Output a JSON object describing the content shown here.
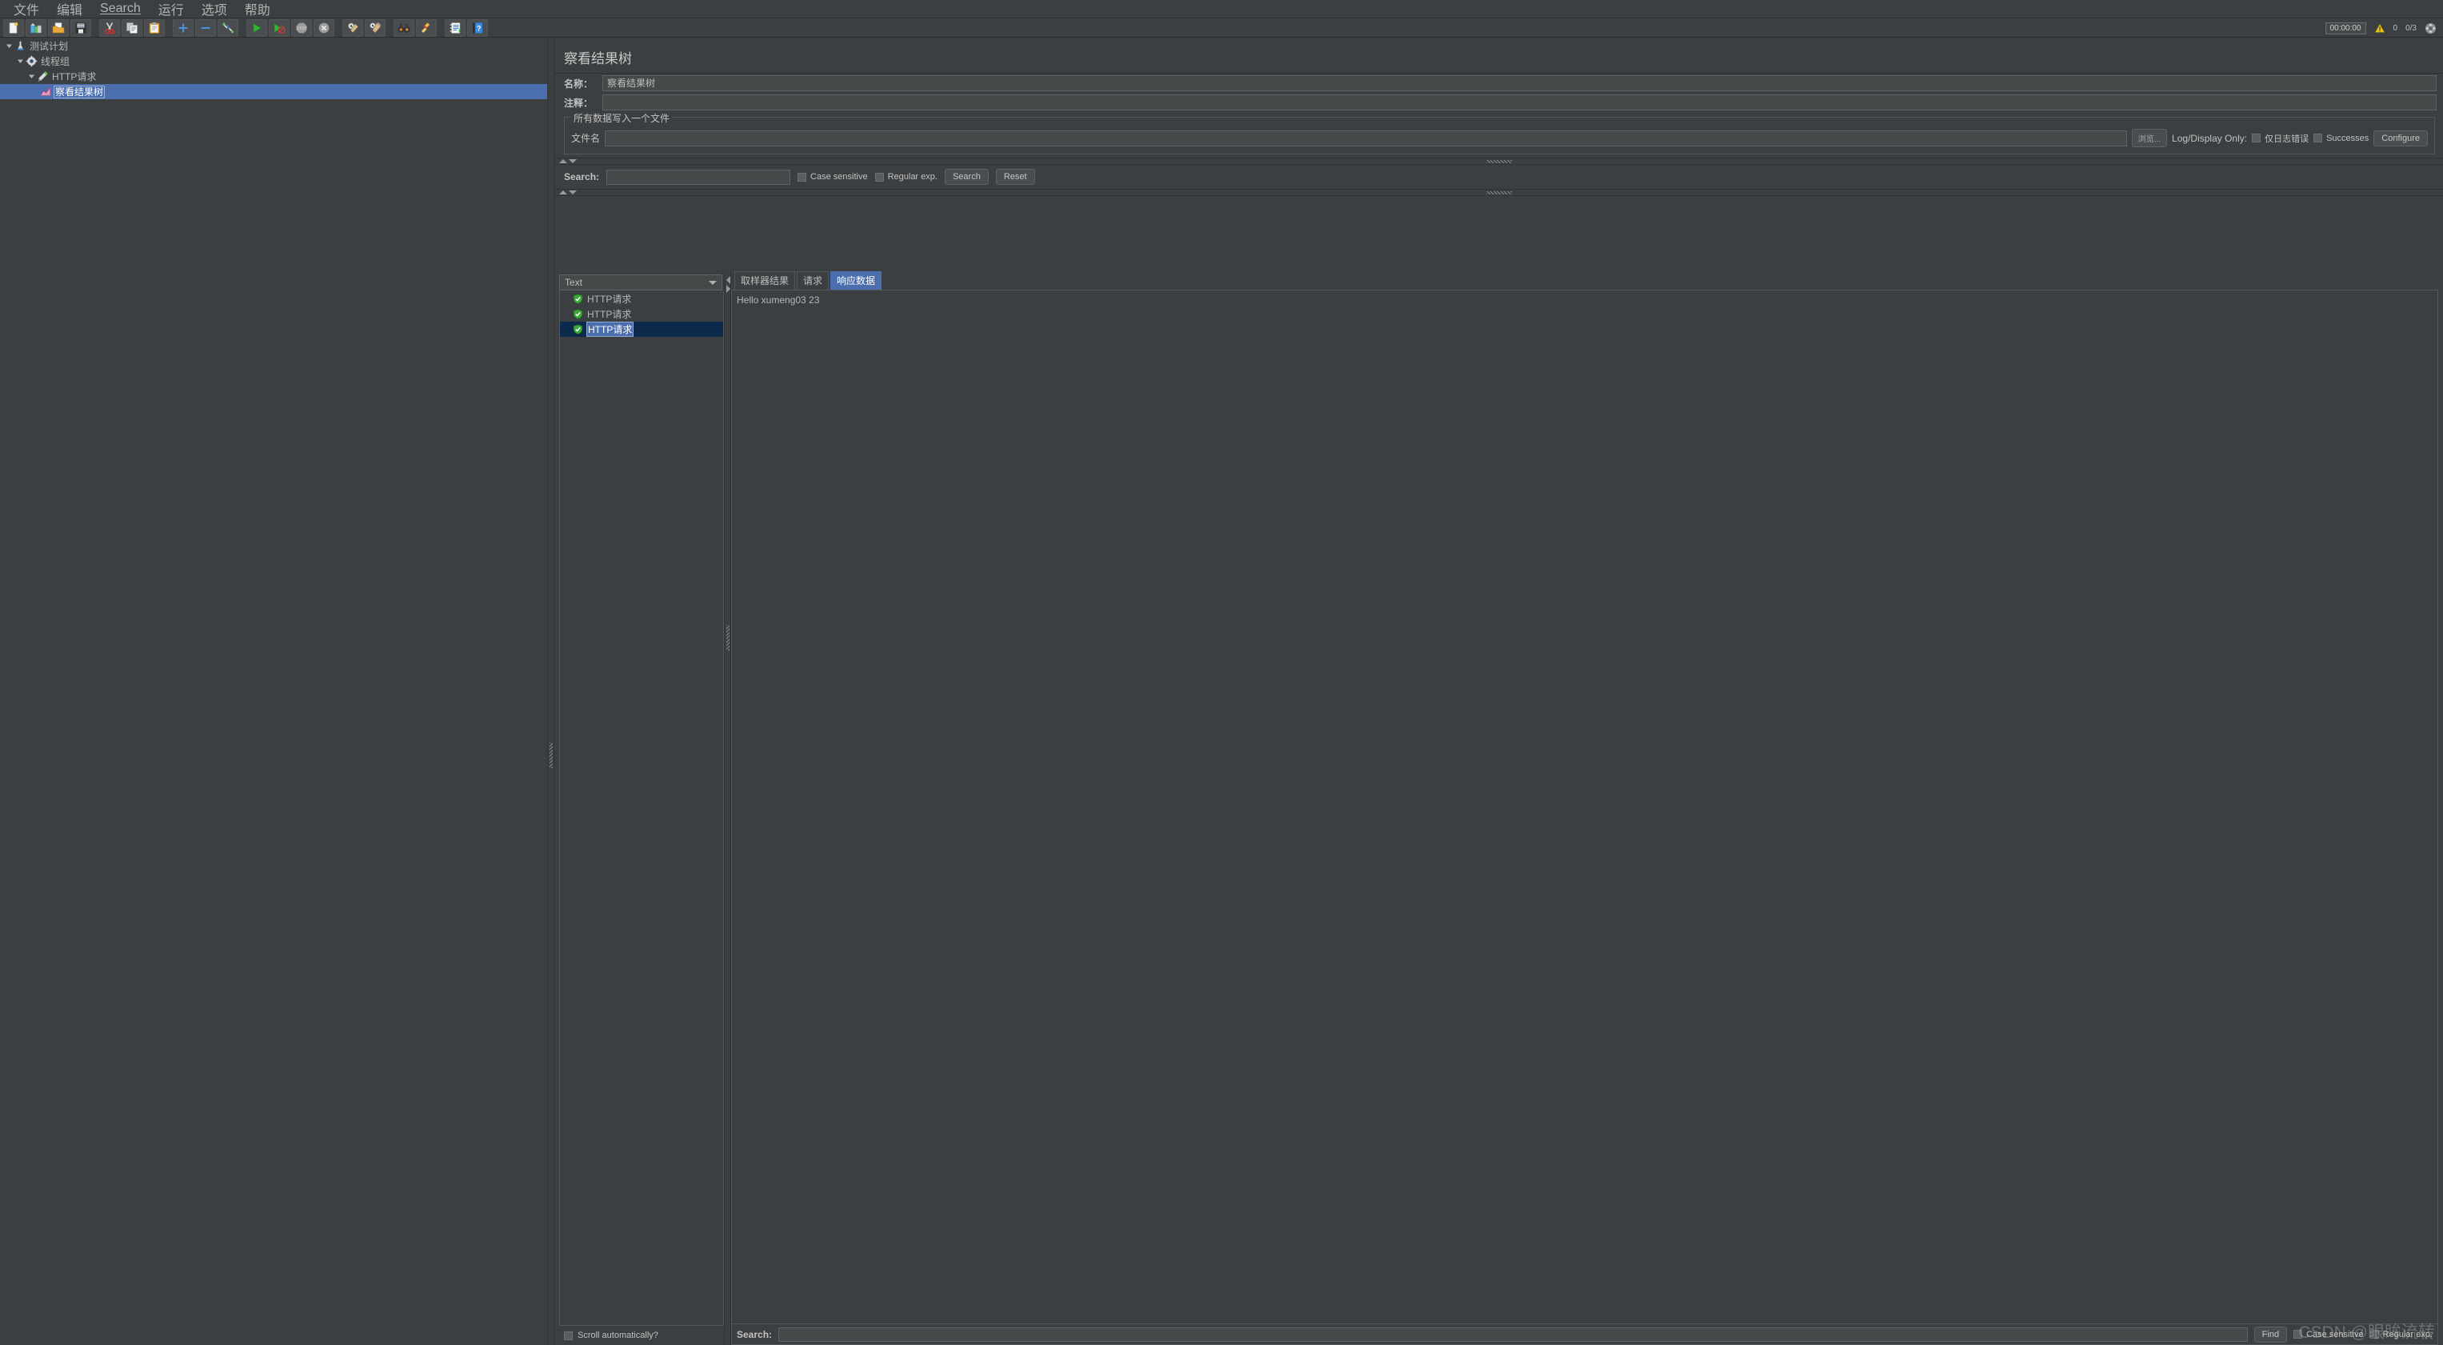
{
  "menubar": {
    "items": [
      {
        "label": "文件",
        "underlined": false
      },
      {
        "label": "编辑",
        "underlined": false
      },
      {
        "label": "Search",
        "underlined": true
      },
      {
        "label": "运行",
        "underlined": false
      },
      {
        "label": "选项",
        "underlined": false
      },
      {
        "label": "帮助",
        "underlined": false
      }
    ]
  },
  "toolbar": {
    "buttons": [
      {
        "icon": "new-file-icon"
      },
      {
        "icon": "templates-icon"
      },
      {
        "icon": "open-folder-icon"
      },
      {
        "icon": "save-icon"
      },
      {
        "sep": true
      },
      {
        "icon": "cut-scissors-icon"
      },
      {
        "icon": "copy-icon"
      },
      {
        "icon": "paste-clipboard-icon"
      },
      {
        "sep": true
      },
      {
        "icon": "expand-plus-icon"
      },
      {
        "icon": "collapse-minus-icon"
      },
      {
        "icon": "toggle-icon"
      },
      {
        "sep": true
      },
      {
        "icon": "start-play-icon"
      },
      {
        "icon": "start-no-timers-icon"
      },
      {
        "icon": "stop-icon"
      },
      {
        "icon": "shutdown-icon"
      },
      {
        "sep": true
      },
      {
        "icon": "clear-gear-icon"
      },
      {
        "icon": "clear-all-gear-icon"
      },
      {
        "sep": true
      },
      {
        "icon": "search-binoculars-icon"
      },
      {
        "icon": "search-reset-broom-icon"
      },
      {
        "sep": true
      },
      {
        "icon": "function-helper-icon"
      },
      {
        "icon": "help-book-icon"
      }
    ],
    "status": {
      "timer": "00:00:00",
      "warnings_count": "0",
      "threads": "0/3",
      "nav_icon": "expand-arrows-icon",
      "warning_icon": "warning-triangle-icon"
    }
  },
  "tree": {
    "nodes": [
      {
        "label": "测试计划",
        "icon": "test-plan-icon",
        "indent": 0,
        "expanded": true,
        "selected": false
      },
      {
        "label": "线程组",
        "icon": "thread-group-gear-icon",
        "indent": 1,
        "expanded": true,
        "selected": false
      },
      {
        "label": "HTTP请求",
        "icon": "http-request-pen-icon",
        "indent": 2,
        "expanded": true,
        "selected": false
      },
      {
        "label": "察看结果树",
        "icon": "view-results-tree-icon",
        "indent": 3,
        "expanded": false,
        "selected": true
      }
    ]
  },
  "panel": {
    "title": "察看结果树",
    "name_label": "名称：",
    "name_value": "察看结果树",
    "comment_label": "注释：",
    "comment_value": "",
    "filegroup": {
      "title": "所有数据写入一个文件",
      "filename_label": "文件名",
      "filename_value": "",
      "browse_button": "浏览...",
      "log_display_label": "Log/Display Only:",
      "errors_checkbox": "仅日志错误",
      "errors_checked": false,
      "successes_checkbox": "Successes",
      "successes_checked": false,
      "configure_button": "Configure"
    },
    "search": {
      "label": "Search:",
      "value": "",
      "case_sensitive_label": "Case sensitive",
      "case_sensitive_checked": false,
      "regex_label": "Regular exp.",
      "regex_checked": false,
      "search_button": "Search",
      "reset_button": "Reset"
    }
  },
  "results": {
    "renderer_selected": "Text",
    "items": [
      {
        "label": "HTTP请求",
        "status": "success",
        "selected": false
      },
      {
        "label": "HTTP请求",
        "status": "success",
        "selected": false
      },
      {
        "label": "HTTP请求",
        "status": "success",
        "selected": true
      }
    ],
    "scroll_auto_label": "Scroll automatically?",
    "scroll_auto_checked": false,
    "tabs": [
      {
        "label": "取样器结果",
        "active": false
      },
      {
        "label": "请求",
        "active": false
      },
      {
        "label": "响应数据",
        "active": true
      }
    ],
    "response_text": "Hello xumeng03 23",
    "find_bar": {
      "label": "Search:",
      "value": "",
      "find_button": "Find",
      "case_sensitive_label": "Case sensitive",
      "case_sensitive_checked": false,
      "regex_label": "Regular exp.",
      "regex_checked": false
    }
  },
  "watermark": "CSDN @眼眸流转",
  "colors": {
    "background": "#3c3f41",
    "selection": "#4b6eaf",
    "text": "#bbbbbb",
    "success": "#4caf50",
    "warning": "#e5c100"
  }
}
